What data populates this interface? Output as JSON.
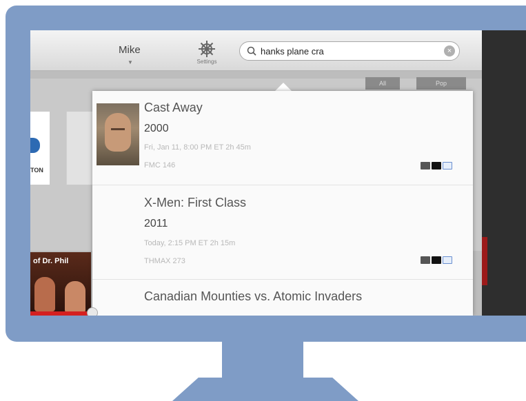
{
  "topbar": {
    "user_name": "Mike",
    "user_caret": "▼",
    "settings_label": "Settings"
  },
  "search": {
    "value": "hanks plane cra",
    "clear_glyph": "×"
  },
  "background": {
    "logo_text": "TON",
    "filter_buttons": [
      "All",
      "Pop"
    ],
    "show_title": "of Dr. Phil"
  },
  "results": [
    {
      "title": "Cast Away",
      "year": "2000",
      "airing": "Fri, Jan 11, 8:00 PM ET   2h 45m",
      "channel": "FMC 146",
      "has_thumbnail": true,
      "badges": [
        "cc-icon",
        "hd-icon",
        "record-icon"
      ]
    },
    {
      "title": "X-Men: First Class",
      "year": "2011",
      "airing": "Today, 2:15 PM ET   2h 15m",
      "channel": "THMAX 273",
      "has_thumbnail": false,
      "badges": [
        "cc-icon",
        "hd-icon",
        "record-icon"
      ]
    },
    {
      "title": "Canadian Mounties vs. Atomic Invaders",
      "year": "",
      "airing": "",
      "channel": "",
      "has_thumbnail": false,
      "badges": []
    }
  ],
  "colors": {
    "monitor": "#7f9cc6",
    "accent_red": "#d42020",
    "badge_blue": "#6a8fd0"
  }
}
